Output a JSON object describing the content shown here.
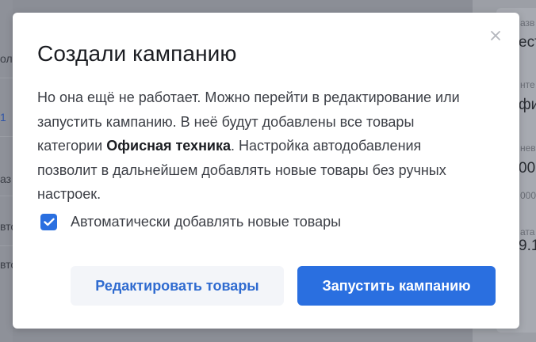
{
  "background": {
    "left_fragments": [
      "ол",
      "1",
      "аз",
      "вто",
      "вто"
    ],
    "right_labels": [
      "азв",
      "нте",
      "нев",
      "000",
      "ата"
    ],
    "right_values": [
      "ест",
      "фи",
      "00",
      "9.1"
    ]
  },
  "modal": {
    "title": "Создали кампанию",
    "body_part1": "Но она ещё не работает. Можно перейти в редактирование или запустить кампанию. В неё будут добавлены все товары категории ",
    "body_category": "Офисная техника",
    "body_part2": ". Настройка автодобавления позволит в дальнейшем добавлять новые товары без ручных настроек.",
    "checkbox_label": "Автоматически добавлять новые товары",
    "checkbox_checked": true,
    "edit_button": "Редактировать товары",
    "launch_button": "Запустить кампанию",
    "close_icon": "close-icon"
  },
  "colors": {
    "accent": "#2a6fe0",
    "secondary_button_bg": "#f3f5f9",
    "overlay": "#8b8e96"
  }
}
